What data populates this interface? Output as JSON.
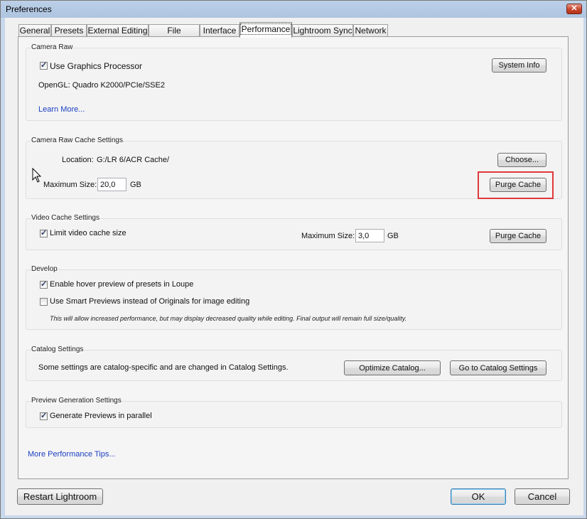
{
  "window": {
    "title": "Preferences",
    "close_glyph": "✕"
  },
  "tabs": [
    {
      "label": "General",
      "active": false
    },
    {
      "label": "Presets",
      "active": false
    },
    {
      "label": "External Editing",
      "active": false
    },
    {
      "label": "File Handling",
      "active": false
    },
    {
      "label": "Interface",
      "active": false
    },
    {
      "label": "Performance",
      "active": true
    },
    {
      "label": "Lightroom Sync",
      "active": false
    },
    {
      "label": "Network",
      "active": false
    }
  ],
  "camera_raw": {
    "title": "Camera Raw",
    "use_gpu_label": "Use Graphics Processor",
    "use_gpu_checked": true,
    "system_info_label": "System Info",
    "opengl_text": "OpenGL: Quadro K2000/PCIe/SSE2",
    "learn_more": "Learn More..."
  },
  "cache_settings": {
    "title": "Camera Raw Cache Settings",
    "location_label": "Location:",
    "location_value": "G:/LR 6/ACR Cache/",
    "choose_label": "Choose...",
    "max_size_label": "Maximum Size:",
    "max_size_value": "20,0",
    "unit": "GB",
    "purge_label": "Purge Cache"
  },
  "video_cache": {
    "title": "Video Cache Settings",
    "limit_label": "Limit video cache size",
    "limit_checked": true,
    "max_size_label": "Maximum Size:",
    "max_size_value": "3,0",
    "unit": "GB",
    "purge_label": "Purge Cache"
  },
  "develop": {
    "title": "Develop",
    "hover_label": "Enable hover preview of presets in Loupe",
    "hover_checked": true,
    "smart_label": "Use Smart Previews instead of Originals for image editing",
    "smart_checked": false,
    "note": "This will allow increased performance, but may display decreased quality while editing. Final output will remain full size/quality."
  },
  "catalog": {
    "title": "Catalog Settings",
    "text": "Some settings are catalog-specific and are changed in Catalog Settings.",
    "optimize_label": "Optimize Catalog...",
    "goto_label": "Go to Catalog Settings"
  },
  "preview": {
    "title": "Preview Generation Settings",
    "parallel_label": "Generate Previews in parallel",
    "parallel_checked": true
  },
  "more_tips": "More Performance Tips...",
  "footer": {
    "restart_label": "Restart Lightroom",
    "ok_label": "OK",
    "cancel_label": "Cancel"
  },
  "colors": {
    "highlight": "#e0393b",
    "link": "#1b3fc2"
  }
}
